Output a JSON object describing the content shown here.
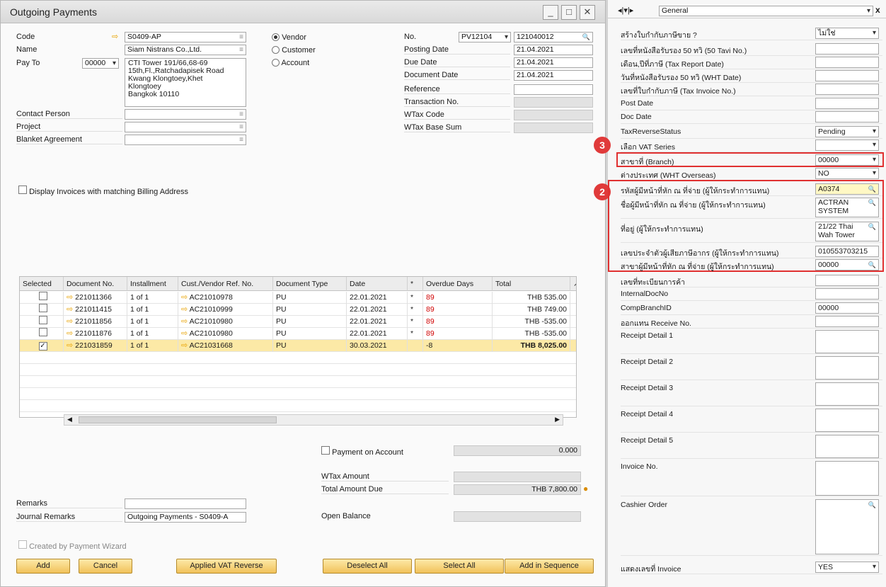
{
  "window": {
    "title": "Outgoing Payments"
  },
  "header": {
    "code_label": "Code",
    "code_value": "S0409-AP",
    "name_label": "Name",
    "name_value": "Siam Nistrans Co.,Ltd.",
    "payto_label": "Pay To",
    "payto_code": "00000",
    "address": [
      "CTI Tower 191/66,68-69",
      "15th,Fl.,Ratchadapisek Road",
      "Kwang Klongtoey,Khet",
      "Klongtoey",
      "Bangkok 10110"
    ],
    "contact_label": "Contact Person",
    "project_label": "Project",
    "blanket_label": "Blanket Agreement",
    "radios": [
      {
        "label": "Vendor",
        "selected": true
      },
      {
        "label": "Customer",
        "selected": false
      },
      {
        "label": "Account",
        "selected": false
      }
    ],
    "no_label": "No.",
    "no_series": "PV12104",
    "no_value": "121040012",
    "posting_label": "Posting Date",
    "posting_value": "21.04.2021",
    "due_label": "Due Date",
    "due_value": "21.04.2021",
    "docdate_label": "Document Date",
    "docdate_value": "21.04.2021",
    "reference_label": "Reference",
    "transaction_label": "Transaction No.",
    "wtaxcode_label": "WTax Code",
    "wtaxbase_label": "WTax Base Sum"
  },
  "display_invoices_label": "Display Invoices with matching Billing Address",
  "table": {
    "columns": [
      "Selected",
      "Document No.",
      "Installment",
      "Cust./Vendor Ref. No.",
      "Document Type",
      "Date",
      "*",
      "Overdue Days",
      "Total"
    ],
    "rows": [
      {
        "checked": false,
        "doc": "221011366",
        "inst": "1 of 1",
        "ref": "AC21010978",
        "type": "PU",
        "date": "22.01.2021",
        "star": "*",
        "overdue": "89",
        "total": "THB 535.00"
      },
      {
        "checked": false,
        "doc": "221011415",
        "inst": "1 of 1",
        "ref": "AC21010999",
        "type": "PU",
        "date": "22.01.2021",
        "star": "*",
        "overdue": "89",
        "total": "THB 749.00"
      },
      {
        "checked": false,
        "doc": "221011856",
        "inst": "1 of 1",
        "ref": "AC21010980",
        "type": "PU",
        "date": "22.01.2021",
        "star": "*",
        "overdue": "89",
        "total": "THB -535.00"
      },
      {
        "checked": false,
        "doc": "221011876",
        "inst": "1 of 1",
        "ref": "AC21010980",
        "type": "PU",
        "date": "22.01.2021",
        "star": "*",
        "overdue": "89",
        "total": "THB -535.00"
      },
      {
        "checked": true,
        "doc": "221031859",
        "inst": "1 of 1",
        "ref": "AC21031668",
        "type": "PU",
        "date": "30.03.2021",
        "star": "",
        "overdue": "-8",
        "total": "THB 8,025.00"
      }
    ]
  },
  "totals": {
    "payment_on_account_label": "Payment on Account",
    "payment_on_account_value": "0.000",
    "wtax_amount_label": "WTax Amount",
    "total_due_label": "Total Amount Due",
    "total_due_value": "THB 7,800.00",
    "open_balance_label": "Open Balance"
  },
  "remarks_label": "Remarks",
  "journal_label": "Journal Remarks",
  "journal_value": "Outgoing Payments - S0409-A",
  "created_by_wizard_label": "Created by Payment Wizard",
  "buttons": {
    "add": "Add",
    "cancel": "Cancel",
    "vat_reverse": "Applied VAT Reverse",
    "deselect": "Deselect All",
    "select": "Select All",
    "sequence": "Add in Sequence"
  },
  "right": {
    "nav_value": "General",
    "badge3": "3",
    "badge2": "2",
    "rows": [
      {
        "label": "สร้างใบกำกับภาษีขาย ?",
        "value": "ไม่ใช่",
        "combo": true
      },
      {
        "label": "เลขที่หนังสือรับรอง 50 ทวิ (50 Tavi No.)",
        "value": ""
      },
      {
        "label": "เดือน,ปีที่ภาษี (Tax Report Date)",
        "value": ""
      },
      {
        "label": "วันที่หนังสือรับรอง 50 ทวิ (WHT Date)",
        "value": ""
      },
      {
        "label": "เลขที่ใบกำกับภาษี (Tax Invoice No.)",
        "value": ""
      },
      {
        "label": "Post Date",
        "value": ""
      },
      {
        "label": "Doc Date",
        "value": ""
      },
      {
        "label": "TaxReverseStatus",
        "value": "Pending",
        "combo": true
      },
      {
        "label": "เลือก VAT Series",
        "value": "",
        "combo": true
      },
      {
        "label": "สาขาที่ (Branch)",
        "value": "00000",
        "combo": true
      },
      {
        "label": "ต่างประเทศ (WHT Overseas)",
        "value": "NO",
        "combo": true
      }
    ],
    "box_rows": [
      {
        "label": "รหัสผู้มีหน้าที่หัก ณ ที่จ่าย (ผู้ให้กระทำการแทน)",
        "value": "A0374"
      },
      {
        "label": "ชื่อผู้มีหน้าที่หัก ณ ที่จ่าย (ผู้ให้กระทำการแทน)",
        "value": "ACTRAN SYSTEM"
      },
      {
        "label": "ที่อยู่ (ผู้ให้กระทำการแทน)",
        "value": "21/22 Thai Wah Tower"
      },
      {
        "label": "เลขประจำตัวผู้เสียภาษีอากร (ผู้ให้กระทำการแทน)",
        "value": "010553703215"
      },
      {
        "label": "สาขาผู้มีหน้าที่หัก ณ ที่จ่าย (ผู้ให้กระทำการแทน)",
        "value": "00000"
      }
    ],
    "lower": [
      {
        "label": "เลขที่ทะเบียนการค้า",
        "value": ""
      },
      {
        "label": "InternalDocNo",
        "value": ""
      },
      {
        "label": "CompBranchID",
        "value": "00000"
      },
      {
        "label": "ออกแทน Receive No.",
        "value": ""
      }
    ],
    "receipts": [
      "Receipt Detail 1",
      "Receipt Detail 2",
      "Receipt Detail 3",
      "Receipt Detail 4",
      "Receipt Detail 5",
      "Invoice No.",
      "Cashier Order"
    ],
    "show_invoice_label": "แสดงเลขที่ Invoice",
    "show_invoice_value": "YES"
  }
}
